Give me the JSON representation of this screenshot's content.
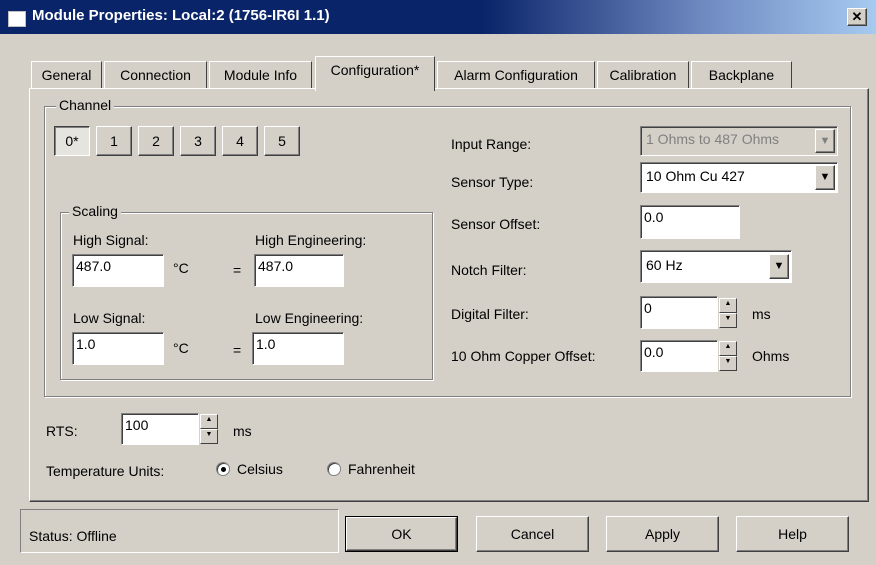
{
  "window": {
    "title": "Module Properties: Local:2 (1756-IR6I 1.1)"
  },
  "tabs": [
    {
      "label": "General"
    },
    {
      "label": "Connection"
    },
    {
      "label": "Module Info"
    },
    {
      "label": "Configuration*"
    },
    {
      "label": "Alarm Configuration"
    },
    {
      "label": "Calibration"
    },
    {
      "label": "Backplane"
    }
  ],
  "channel": {
    "group_label": "Channel",
    "buttons": [
      "0*",
      "1",
      "2",
      "3",
      "4",
      "5"
    ],
    "selected": "0*"
  },
  "scaling": {
    "group_label": "Scaling",
    "high_signal_label": "High Signal:",
    "high_signal_value": "487.0",
    "high_eng_label": "High Engineering:",
    "high_eng_value": "487.0",
    "low_signal_label": "Low Signal:",
    "low_signal_value": "1.0",
    "low_eng_label": "Low Engineering:",
    "low_eng_value": "1.0",
    "unit": "°C",
    "equals": "="
  },
  "settings": {
    "input_range_label": "Input Range:",
    "input_range_value": "1 Ohms to 487 Ohms",
    "sensor_type_label": "Sensor Type:",
    "sensor_type_value": "10 Ohm Cu 427",
    "sensor_offset_label": "Sensor Offset:",
    "sensor_offset_value": "0.0",
    "notch_filter_label": "Notch Filter:",
    "notch_filter_value": "60 Hz",
    "digital_filter_label": "Digital Filter:",
    "digital_filter_value": "0",
    "digital_filter_unit": "ms",
    "copper_offset_label": "10 Ohm Copper Offset:",
    "copper_offset_value": "0.0",
    "copper_offset_unit": "Ohms"
  },
  "rts": {
    "label": "RTS:",
    "value": "100",
    "unit": "ms"
  },
  "temperature_units": {
    "label": "Temperature Units:",
    "options": [
      "Celsius",
      "Fahrenheit"
    ],
    "selected": "Celsius"
  },
  "status": {
    "text": "Status:  Offline"
  },
  "buttons": {
    "ok": "OK",
    "cancel": "Cancel",
    "apply": "Apply",
    "help": "Help"
  },
  "icons": {
    "close": "close-icon",
    "spin_up": "spin-up-icon",
    "spin_down": "spin-down-icon",
    "dropdown": "chevron-down-icon"
  }
}
